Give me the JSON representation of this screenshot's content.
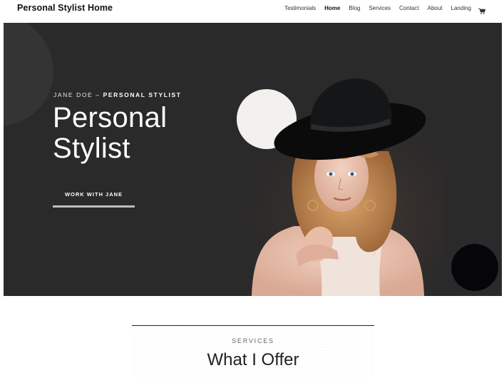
{
  "header": {
    "site_title": "Personal Stylist Home",
    "nav": [
      "Testimonials",
      "Home",
      "Blog",
      "Services",
      "Contact",
      "About",
      "Landing"
    ],
    "active": "Home",
    "cart_icon": "cart-icon"
  },
  "hero": {
    "eyebrow_name": "JANE DOE – ",
    "eyebrow_role": "PERSONAL STYLIST",
    "title_line1": "Personal",
    "title_line2": "Stylist",
    "cta_label": "WORK WITH JANE",
    "background_color": "#2b2a2a"
  },
  "services": {
    "label": "SERVICES",
    "heading": "What I Offer"
  }
}
